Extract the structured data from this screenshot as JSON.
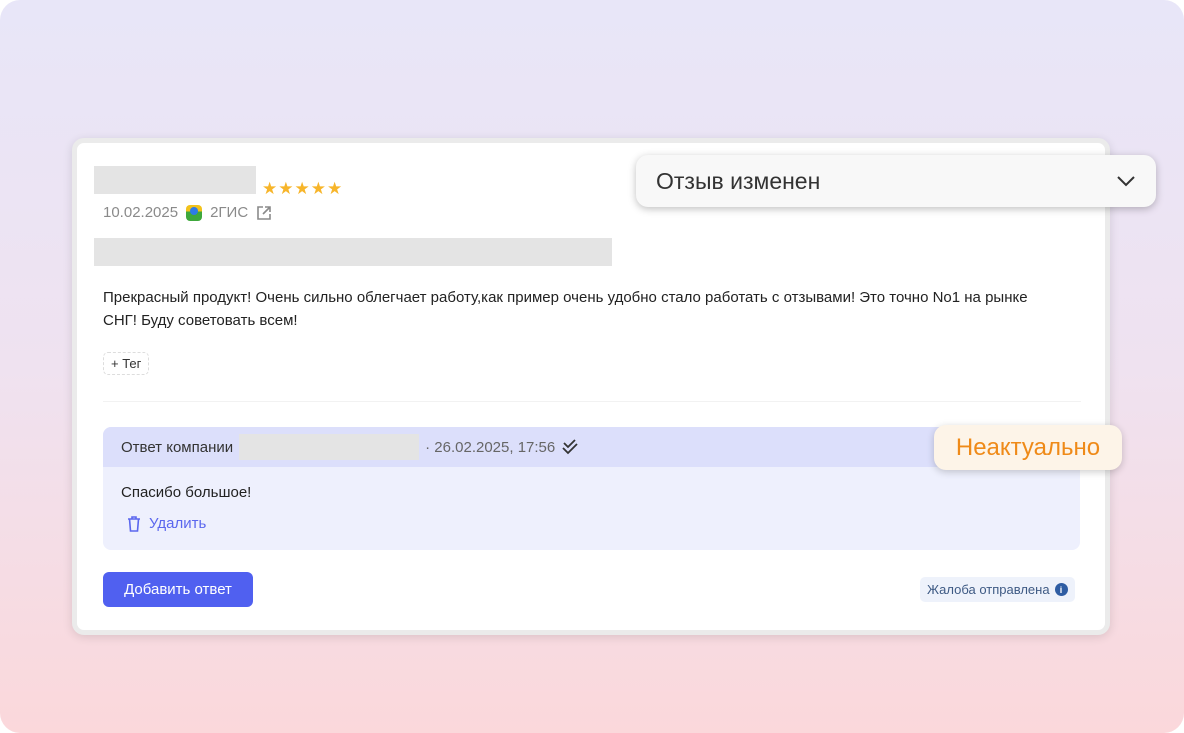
{
  "review": {
    "rating": 5,
    "stars": "★★★★★",
    "date": "10.02.2025",
    "source": "2ГИС",
    "text": "Прекрасный продукт! Очень сильно облегчает работу,как пример очень удобно стало работать с отзывами! Это точно No1 на рынке СНГ! Буду советовать всем!",
    "tag_button": "+ Тег"
  },
  "reply": {
    "label": "Ответ компании",
    "date": "· 26.02.2025, 17:56",
    "text": "Спасибо большое!",
    "delete": "Удалить"
  },
  "actions": {
    "add_reply": "Добавить ответ",
    "complaint": "Жалоба отправлена"
  },
  "status_dropdown": {
    "value": "Отзыв изменен"
  },
  "status_badge": "Неактуально"
}
